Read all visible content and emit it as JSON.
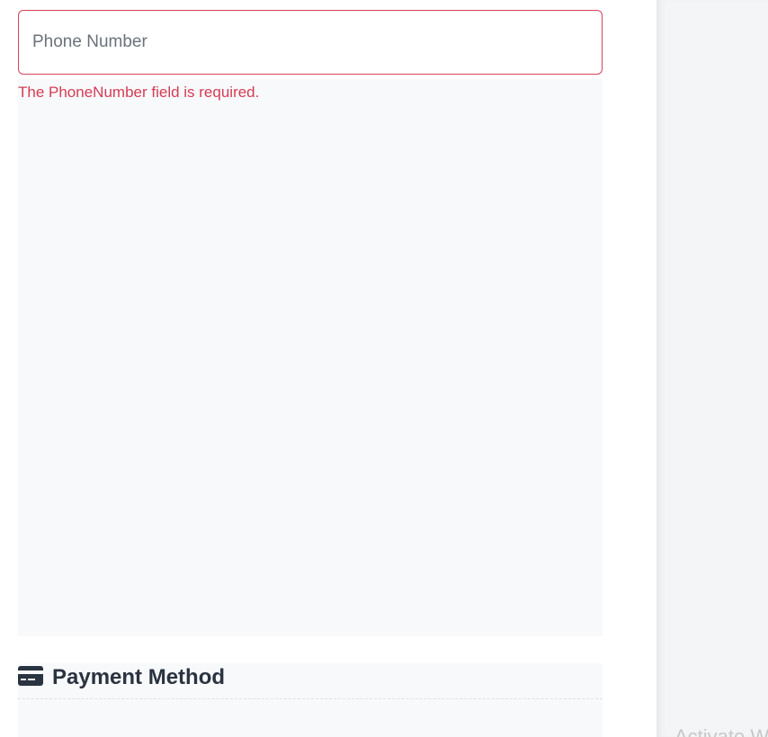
{
  "phone_field": {
    "placeholder": "Phone Number",
    "value": "",
    "error_message": "The PhoneNumber field is required."
  },
  "payment": {
    "title": "Payment Method",
    "icon": "credit-card-icon"
  },
  "watermark": {
    "text": "Activate W"
  },
  "colors": {
    "error": "#d43c55",
    "error_border": "#d4435b",
    "heading": "#2a3340",
    "panel_bg": "#f8f9fa"
  }
}
